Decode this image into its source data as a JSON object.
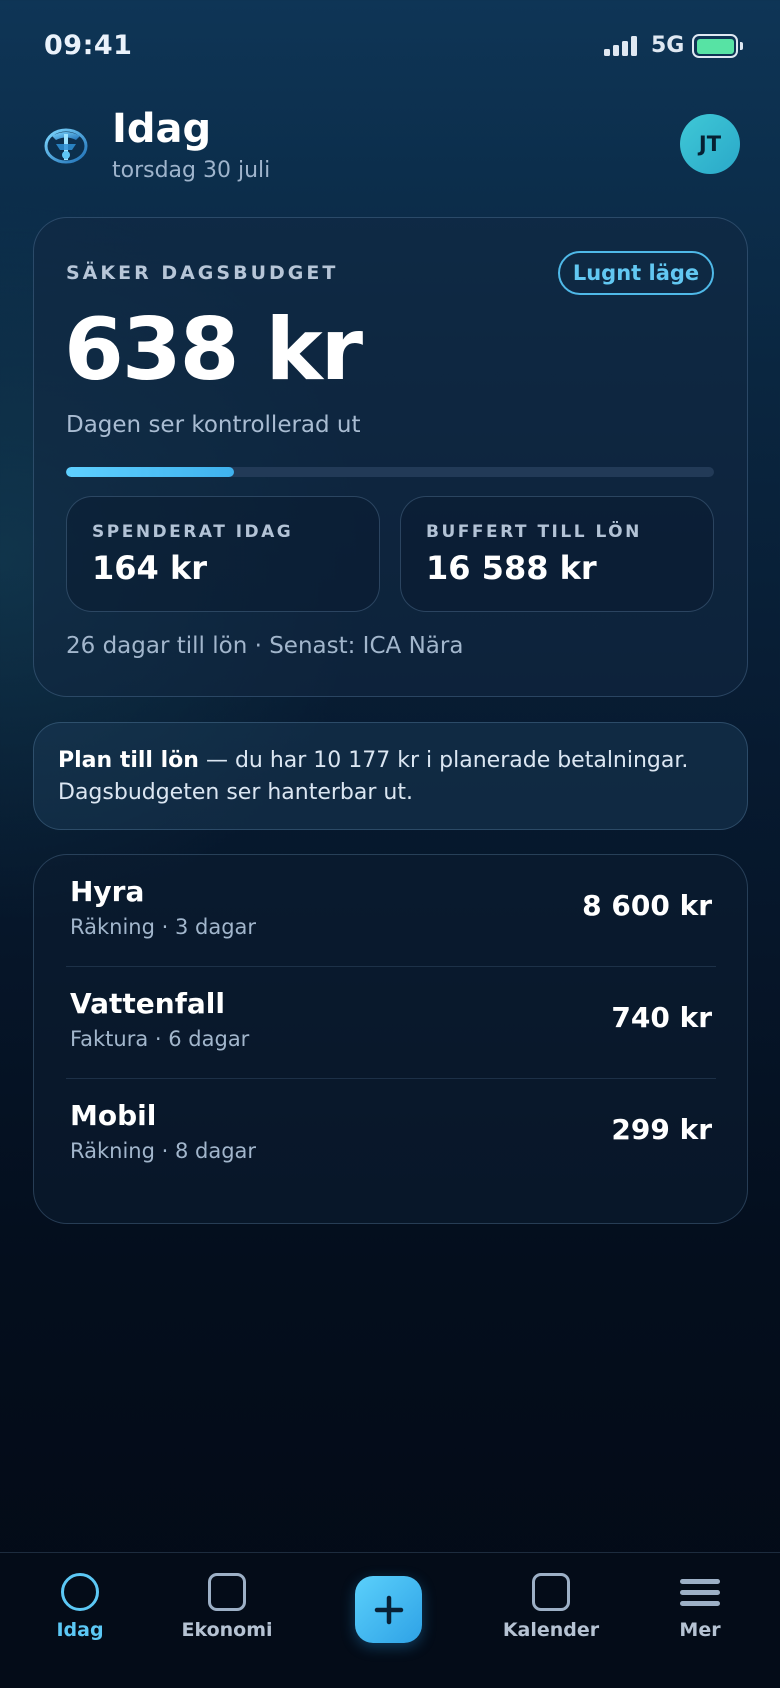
{
  "status_bar": {
    "time": "09:41",
    "network": "5G",
    "battery_level": 1.0,
    "signal_bars": 4
  },
  "header": {
    "title": "Idag",
    "date": "torsdag 30 juli",
    "avatar_initials": "JT",
    "logo_icon": "shield-logo-icon"
  },
  "budget": {
    "label": "SÄKER DAGSBUDGET",
    "mode_label": "Lugnt läge",
    "amount": "638 kr",
    "mood": "Dagen ser kontrollerad ut",
    "progress": 0.26,
    "spent_label": "SPENDERAT IDAG",
    "spent_value": "164 kr",
    "buffer_label": "BUFFERT TILL LÖN",
    "buffer_value": "16 588 kr",
    "footnote": "26 dagar till lön · Senast: ICA Nära"
  },
  "plan": {
    "title": "Plan till lön",
    "text": " — du har 10 177 kr i planerade betalningar. Dagsbudgeten ser hanterbar ut."
  },
  "bills": [
    {
      "name": "Hyra",
      "meta": "Räkning · 3 dagar",
      "amount": "8 600 kr"
    },
    {
      "name": "Vattenfall",
      "meta": "Faktura · 6 dagar",
      "amount": "740 kr"
    },
    {
      "name": "Mobil",
      "meta": "Räkning · 8 dagar",
      "amount": "299 kr"
    }
  ],
  "nav": {
    "items": [
      {
        "label": "Idag",
        "icon": "circle-icon",
        "active": true
      },
      {
        "label": "Ekonomi",
        "icon": "square-icon",
        "active": false
      },
      {
        "label": "",
        "icon": "plus-icon",
        "active": false
      },
      {
        "label": "Kalender",
        "icon": "square-icon",
        "active": false
      },
      {
        "label": "Mer",
        "icon": "menu-icon",
        "active": false
      }
    ]
  },
  "colors": {
    "accent": "#5cc8f5",
    "battery": "#57e3a4",
    "avatar": "#3fc8d6"
  }
}
